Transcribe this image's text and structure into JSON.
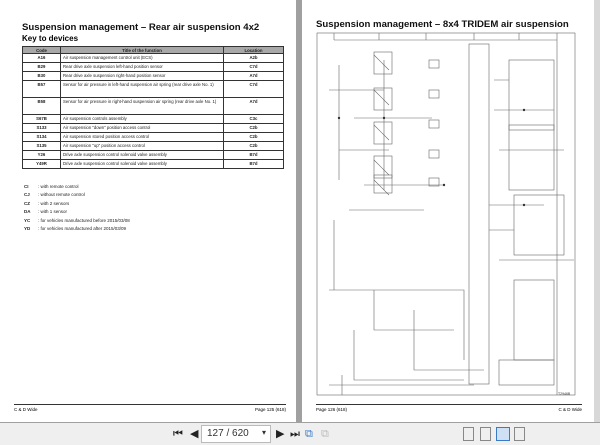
{
  "left_page": {
    "title": "Suspension management – Rear air suspension 4x2",
    "subtitle": "Key to devices",
    "columns": [
      "Code",
      "Title of the function",
      "Location"
    ],
    "rows": [
      [
        "A16",
        "Air suspension management control unit (ECS)",
        "A2b"
      ],
      [
        "B29",
        "Rear drive axle suspension left-hand position sensor",
        "C7d"
      ],
      [
        "B30",
        "Rear drive axle suspension right-hand position sensor",
        "A7d"
      ],
      [
        "B57",
        "Sensor for air pressure in left-hand suspension air spring (rear drive axle No. 1)",
        "C7d"
      ],
      [
        "B58",
        "Sensor for air pressure in right-hand suspension air spring (rear drive axle No. 1)",
        "A7d"
      ],
      [
        "S67B",
        "Air suspension controls assembly",
        "C3c"
      ],
      [
        "S133",
        "Air suspension \"down\" position access control",
        "C2b"
      ],
      [
        "S134",
        "Air suspension stored position access control",
        "C2b"
      ],
      [
        "S135",
        "Air suspension \"up\" position access control",
        "C2b"
      ],
      [
        "Y26",
        "Drive axle suspension control solenoid valve assembly",
        "B7d"
      ],
      [
        "Y49R",
        "Drive axle suspension control solenoid valve assembly",
        "B7d"
      ]
    ],
    "notes": [
      [
        "CI",
        ": with remote control"
      ],
      [
        "CJ",
        ": without remote control"
      ],
      [
        "CZ",
        ": with 2 sensors"
      ],
      [
        "DA",
        ": with 1 sensor"
      ],
      [
        "YC",
        ": for vehicles manufactured before 2015/03/08"
      ],
      [
        "YD",
        ": for vehicles manufactured after 2015/03/09"
      ]
    ],
    "footer_left": "C & D Wide",
    "footer_right": "Page 125 (618)"
  },
  "right_page": {
    "title": "Suspension management – 8x4 TRIDEM air suspension",
    "diagram_ref": "T2946B",
    "footer_left": "Page 126 (618)",
    "footer_right": "C & D Wide"
  },
  "toolbar": {
    "page_value": "127 / 620"
  }
}
